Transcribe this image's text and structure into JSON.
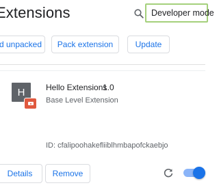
{
  "header": {
    "title": "Extensions",
    "search_icon": "search-icon",
    "developer_mode_label": "Developer mode"
  },
  "toolbar": {
    "load_unpacked_label": "d unpacked",
    "pack_extension_label": "Pack extension",
    "update_label": "Update"
  },
  "extension": {
    "icon_letter": "H",
    "name": "Hello Extensions",
    "version": "1.0",
    "description": "Base Level Extension",
    "id_text": "ID: cfalipoohakefliiblhmbapofckaebjo",
    "details_label": "Details",
    "remove_label": "Remove",
    "reload_icon": "reload-icon",
    "enabled": true
  },
  "colors": {
    "accent": "#1a73e8",
    "highlight_border": "#a4d07b",
    "badge": "#e0593f"
  }
}
